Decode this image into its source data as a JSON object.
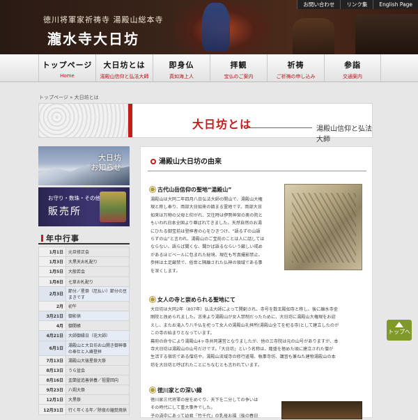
{
  "header": {
    "subtitle": "徳川将軍家祈祷寺 湯殿山総本寺",
    "title": "瀧水寺大日坊",
    "toplinks": [
      "お問い合わせ",
      "リンク集",
      "English Page"
    ]
  },
  "nav": [
    {
      "label": "トップページ",
      "sub": "Home"
    },
    {
      "label": "大日坊とは",
      "sub": "湯殿山信仰と弘法大師"
    },
    {
      "label": "即身仏",
      "sub": "真如海上人"
    },
    {
      "label": "拝観",
      "sub": "宝仏のご案内"
    },
    {
      "label": "祈祷",
      "sub": "ご祈祷の申し込み"
    },
    {
      "label": "参詣",
      "sub": "交通案内"
    }
  ],
  "breadcrumb": "トップページ » 大日坊とは",
  "banner": {
    "title": "大日坊とは",
    "subtitle": "湯殿山信仰と弘法大師"
  },
  "sidebar": {
    "info_label": [
      "大日坊",
      "お知らせ"
    ],
    "shop_line1": "お守り・数珠・その他",
    "shop_line2": "販売所",
    "events_title": "年中行事",
    "events": [
      {
        "date": "1月1日",
        "text": "元旦修正会"
      },
      {
        "date": "1月3日",
        "text": "大黒天お札配り"
      },
      {
        "date": "1月5日",
        "text": "大般若会"
      },
      {
        "date": "1月8日",
        "text": "七草お札配り"
      },
      {
        "date": "2月3日",
        "text": "節分／星祭（厄払い）節分の豆まきです",
        "hi": true
      },
      {
        "date": "2月",
        "text": "初午"
      },
      {
        "date": "3月21日",
        "text": "御影供",
        "hi": true
      },
      {
        "date": "4月",
        "text": "御開帳"
      },
      {
        "date": "4月21日",
        "text": "大師御縁日（花大師）",
        "hi": true
      },
      {
        "date": "6月1日",
        "text": "湯殿山と大日坊お山開き御神事の奉仕と入峰登拝",
        "hi": true
      },
      {
        "date": "7月13日",
        "text": "湯殿山大祓星祭大祭"
      },
      {
        "date": "8月13日",
        "text": "うら盆会"
      },
      {
        "date": "8月16日",
        "text": "盂蘭盆追善供養／祖霊回向"
      },
      {
        "date": "9月23日",
        "text": "八朔大祭"
      },
      {
        "date": "12月1日",
        "text": "大黒祭"
      },
      {
        "date": "12月31日",
        "text": "行く年くる年／除夜の鐘焚焼供"
      }
    ]
  },
  "main": {
    "section_title": "湯殿山大日坊の由来",
    "h1": "古代山岳信仰の聖地“湯殿山”",
    "p1": [
      "湯殿山は大同二年四月八日弘法大師の開山で、湯殿山大権",
      "現と称し奉り、両部大日如来の鎮まる霊地です。両部大日",
      "如来は万物の父母と仰がれ、又往時は伊勢神宮の奥の院と",
      "もいわれ日本全国より尊ばれてきました。天然自然のお湯",
      "にひたる御宝前は登拝者の心をひきつけ、“語るずの山語",
      "らずの山”と言われ、湯殿山のご宝前のことは人に話しては",
      "ならない、語らば聞くな、聞かば語るならいう厳しい戒め",
      "があるほどベールに包まれた秘境、現在も写真撮影禁止、",
      "参拝は土足厳禁で、俗世と隔離された仏神の領域である事",
      "を深くします。"
    ],
    "h2": "女人の寺と崇められる聖地にて",
    "p2": [
      "大日坊は大同2年（807年）弘法大師によって開創され、寺号を数王殿如寺と称し、後に離水寺金",
      "剛院と改められました。古来より湯殿山が女人禁制だったために、大日坊に湯殿山大権現をお迎",
      "えし、またお滝入り八千仏を祀って女人の湯殿山礼拝所(湯殿山全てを祀る寺)として建立したのが",
      "この寺の始まりとなっています。",
      "幕府の命令により湯殿山4ヶ寺共同運営となりましたが、他の三寺院は元の山号がありますが、本",
      "寺大日坊は湯殿山の山号だけです。「大日坊」という名称は、隆盛を極めた頃に建立された僧が",
      "生活する宿坊である僧坊や、湯殿山流域寺の修行道場、執事寺坊、講習も兼ねた建物湯殿山の本",
      "坊を大日坊と呼ばれたことにちなむとも言われています。"
    ],
    "h3": "徳川家との深い縁",
    "p3": [
      "徳川家三代将軍の座をめぐり、天下を二分しての争いは",
      "その時代にして重大事件でした。",
      "子の渦中にあって幼君「竹千代」の乳母お福（後の春日"
    ]
  },
  "pagetop": "トップへ"
}
